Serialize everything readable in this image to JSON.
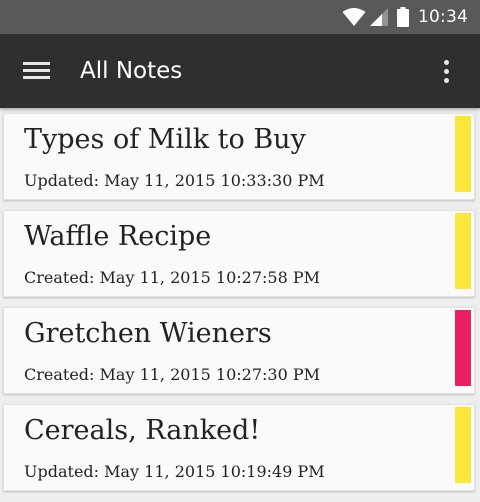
{
  "status_bar": {
    "time": "10:34"
  },
  "app_bar": {
    "title": "All Notes"
  },
  "colors": {
    "yellow": "#fbe63b",
    "pink": "#e91e63",
    "app_bar": "#2f2f2f",
    "status_bar": "#595959"
  },
  "notes": [
    {
      "title": "Types of Milk to Buy",
      "meta": "Updated: May 11, 2015 10:33:30 PM",
      "color": "#fbe63b"
    },
    {
      "title": "Waffle Recipe",
      "meta": "Created: May 11, 2015 10:27:58 PM",
      "color": "#fbe63b"
    },
    {
      "title": "Gretchen Wieners",
      "meta": "Created: May 11, 2015 10:27:30 PM",
      "color": "#e91e63"
    },
    {
      "title": "Cereals, Ranked!",
      "meta": "Updated: May 11, 2015 10:19:49 PM",
      "color": "#fbe63b"
    }
  ]
}
